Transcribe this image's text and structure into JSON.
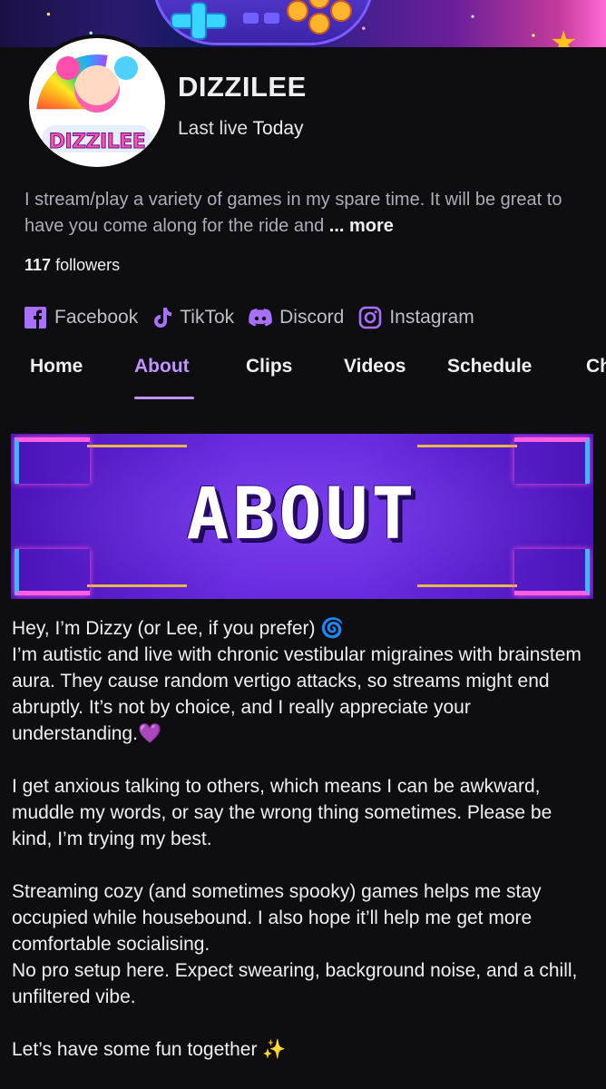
{
  "banner": {},
  "channel": {
    "name": "DIZZILEE",
    "last_live_label": "Last live",
    "last_live_value": "Today",
    "avatar_text": "DIZZILEE",
    "bio": "I stream/play a variety of games in my spare time.  It will be great to have you come along for the ride and",
    "bio_more": "... more",
    "followers_count": "117",
    "followers_label": "followers"
  },
  "socials": [
    {
      "label": "Facebook",
      "icon": "facebook-icon"
    },
    {
      "label": "TikTok",
      "icon": "tiktok-icon"
    },
    {
      "label": "Discord",
      "icon": "discord-icon"
    },
    {
      "label": "Instagram",
      "icon": "instagram-icon"
    }
  ],
  "tabs": [
    {
      "label": "Home",
      "active": false
    },
    {
      "label": "About",
      "active": true
    },
    {
      "label": "Clips",
      "active": false
    },
    {
      "label": "Videos",
      "active": false
    },
    {
      "label": "Schedule",
      "active": false
    },
    {
      "label": "Ch",
      "active": false
    }
  ],
  "about": {
    "panel_title": "ABOUT",
    "paragraphs": [
      "Hey, I’m Dizzy (or Lee, if you prefer) 🌀",
      "I’m autistic and live with chronic vestibular migraines with brainstem aura. They cause random vertigo attacks, so streams might end abruptly. It’s not by choice, and I really appreciate your understanding.💜",
      "",
      "I get anxious talking to others, which means I can be awkward, muddle my words, or say the wrong thing sometimes. Please be kind, I’m trying my best.",
      "",
      "Streaming cozy (and sometimes spooky) games helps me stay occupied while housebound. I also hope it’ll help me get more comfortable socialising.",
      "No pro setup here. Expect swearing, background noise, and a chill, unfiltered vibe.",
      "",
      "Let’s have some fun together ✨"
    ]
  },
  "colors": {
    "accent": "#bf94ff",
    "icon_purple": "#a970ff",
    "background": "#0e0e10"
  }
}
